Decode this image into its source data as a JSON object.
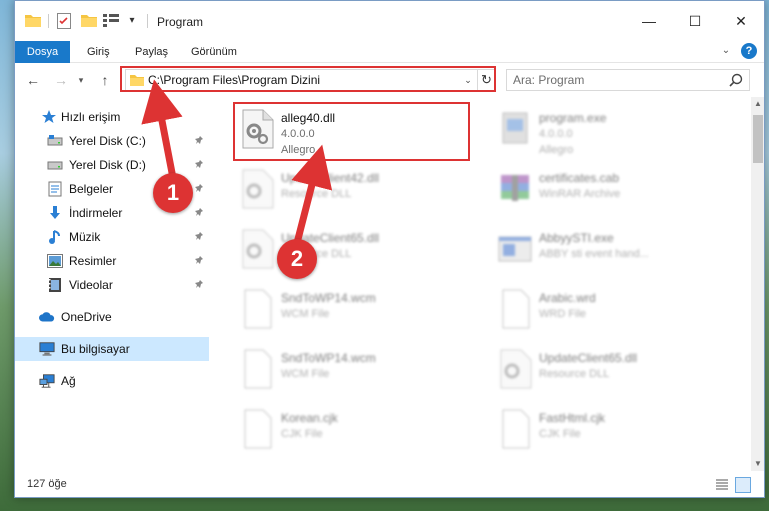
{
  "window": {
    "title": "Program",
    "controls": {
      "minimize": "—",
      "maximize": "☐",
      "close": "✕"
    }
  },
  "ribbon": {
    "tabs": [
      "Dosya",
      "Giriş",
      "Paylaş",
      "Görünüm"
    ],
    "help": "?"
  },
  "nav": {
    "address_path": "C:\\Program Files\\Program Dizini",
    "search_placeholder": "Ara: Program"
  },
  "sidebar": {
    "items": [
      {
        "label": "Hızlı erişim",
        "icon": "star-icon",
        "pinned": false
      },
      {
        "label": "Yerel Disk (C:)",
        "icon": "drive-icon",
        "pinned": true
      },
      {
        "label": "Yerel Disk (D:)",
        "icon": "drive-icon",
        "pinned": true
      },
      {
        "label": "Belgeler",
        "icon": "documents-icon",
        "pinned": true
      },
      {
        "label": "İndirmeler",
        "icon": "downloads-icon",
        "pinned": true
      },
      {
        "label": "Müzik",
        "icon": "music-icon",
        "pinned": true
      },
      {
        "label": "Resimler",
        "icon": "pictures-icon",
        "pinned": true
      },
      {
        "label": "Videolar",
        "icon": "videos-icon",
        "pinned": true
      },
      {
        "label": "OneDrive",
        "icon": "onedrive-icon",
        "pinned": false
      },
      {
        "label": "Bu bilgisayar",
        "icon": "computer-icon",
        "pinned": false,
        "selected": true
      },
      {
        "label": "Ağ",
        "icon": "network-icon",
        "pinned": false
      }
    ]
  },
  "files": [
    {
      "name": "alleg40.dll",
      "line2": "4.0.0.0",
      "line3": "Allegro",
      "icon": "dll-gear-icon",
      "highlighted": true
    },
    {
      "name": "program.exe",
      "line2": "4.0.0.0",
      "line3": "Allegro",
      "icon": "exe-icon"
    },
    {
      "name": "UpdateClient42.dll",
      "line2": "Resource DLL",
      "line3": "",
      "icon": "dll-gear-icon"
    },
    {
      "name": "certificates.cab",
      "line2": "WinRAR Archive",
      "line3": "",
      "icon": "archive-icon"
    },
    {
      "name": "UpdateClient65.dll",
      "line2": "Resource DLL",
      "line3": "",
      "icon": "dll-gear-icon"
    },
    {
      "name": "AbbyySTI.exe",
      "line2": "ABBY sti event hand...",
      "line3": "",
      "icon": "app-window-icon"
    },
    {
      "name": "SndToWP14.wcm",
      "line2": "WCM File",
      "line3": "",
      "icon": "blank-file-icon"
    },
    {
      "name": "Arabic.wrd",
      "line2": "WRD File",
      "line3": "",
      "icon": "blank-file-icon"
    },
    {
      "name": "SndToWP14.wcm",
      "line2": "WCM File",
      "line3": "",
      "icon": "blank-file-icon"
    },
    {
      "name": "UpdateClient65.dll",
      "line2": "Resource DLL",
      "line3": "",
      "icon": "dll-gear-icon"
    },
    {
      "name": "Korean.cjk",
      "line2": "CJK File",
      "line3": "",
      "icon": "blank-file-icon"
    },
    {
      "name": "FastHtml.cjk",
      "line2": "CJK File",
      "line3": "",
      "icon": "blank-file-icon"
    }
  ],
  "status": {
    "item_count": "127 öğe"
  },
  "annotations": {
    "step1": "1",
    "step2": "2",
    "color": "#d33333"
  }
}
